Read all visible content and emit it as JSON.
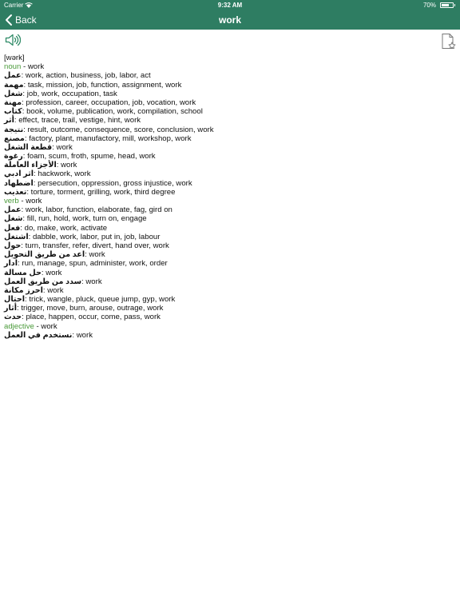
{
  "status_bar": {
    "carrier": "Carrier",
    "time": "9:32 AM",
    "battery": "70%",
    "battery_level": 0.7
  },
  "nav": {
    "back_label": "Back",
    "title": "work"
  },
  "entry": {
    "transcription": "[wərk]",
    "groups": [
      {
        "pos": "noun",
        "headword": "work",
        "rows": [
          {
            "ar": "عمل",
            "en": "work, action, business, job, labor, act"
          },
          {
            "ar": "مهمة",
            "en": "task, mission, job, function, assignment, work"
          },
          {
            "ar": "شغل",
            "en": "job, work, occupation, task"
          },
          {
            "ar": "مهنة",
            "en": "profession, career, occupation, job, vocation, work"
          },
          {
            "ar": "كتاب",
            "en": "book, volume, publication, work, compilation, school"
          },
          {
            "ar": "أثر",
            "en": "effect, trace, trail, vestige, hint, work"
          },
          {
            "ar": "نتيجة",
            "en": "result, outcome, consequence, score, conclusion, work"
          },
          {
            "ar": "مصنع",
            "en": "factory, plant, manufactory, mill, workshop, work"
          },
          {
            "ar": "قطعة الشغل",
            "en": "work"
          },
          {
            "ar": "رغوة",
            "en": "foam, scum, froth, spume, head, work"
          },
          {
            "ar": "الأجزاء العاملة",
            "en": "work"
          },
          {
            "ar": "اثر ادبي",
            "en": "hackwork, work"
          },
          {
            "ar": "اضطهاد",
            "en": "persecution, oppression, gross injustice, work"
          },
          {
            "ar": "تعذيب",
            "en": "torture, torment, grilling, work, third degree"
          }
        ]
      },
      {
        "pos": "verb",
        "headword": "work",
        "rows": [
          {
            "ar": "عمل",
            "en": "work, labor, function, elaborate, fag, gird on"
          },
          {
            "ar": "شغل",
            "en": "fill, run, hold, work, turn on, engage"
          },
          {
            "ar": "فعل",
            "en": "do, make, work, activate"
          },
          {
            "ar": "اشتغل",
            "en": "dabble, work, labor, put in, job, labour"
          },
          {
            "ar": "حول",
            "en": "turn, transfer, refer, divert, hand over, work"
          },
          {
            "ar": "اعد من طريق التحويل",
            "en": "work"
          },
          {
            "ar": "ادار",
            "en": "run, manage, spun, administer, work, order"
          },
          {
            "ar": "حل مسالة",
            "en": "work"
          },
          {
            "ar": "سدد من طريق العمل",
            "en": "work"
          },
          {
            "ar": "احرز مكانة",
            "en": "work"
          },
          {
            "ar": "احتال",
            "en": "trick, wangle, pluck, queue jump, gyp, work"
          },
          {
            "ar": "أثار",
            "en": "trigger, move, burn, arouse, outrage, work"
          },
          {
            "ar": "حدث",
            "en": "place, happen, occur, come, pass, work"
          }
        ]
      },
      {
        "pos": "adjective",
        "headword": "work",
        "rows": [
          {
            "ar": "نستخدم في العمل",
            "en": "work"
          }
        ]
      }
    ]
  },
  "icons": {
    "back": "chevron-left-icon",
    "speaker": "speaker-icon",
    "bookmark": "bookmark-star-icon"
  },
  "colors": {
    "nav_bg": "#2e7d62",
    "pos": "#4a9a3a",
    "icon": "#2e8a66"
  }
}
